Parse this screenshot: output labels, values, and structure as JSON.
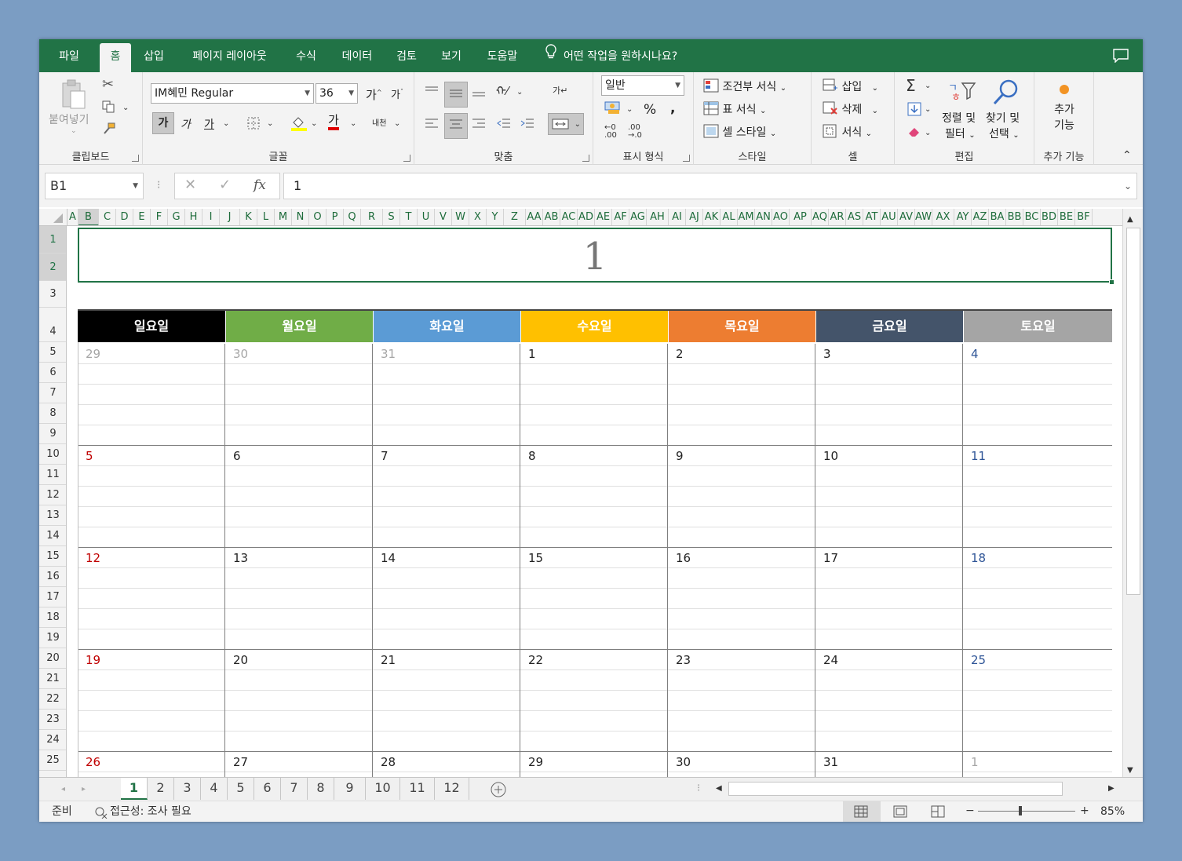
{
  "menu": {
    "tabs": [
      "파일",
      "홈",
      "삽입",
      "페이지 레이아웃",
      "수식",
      "데이터",
      "검토",
      "보기",
      "도움말"
    ],
    "tell_me": "어떤 작업을 원하시나요?"
  },
  "ribbon": {
    "clipboard": {
      "paste": "붙여넣기",
      "label": "클립보드"
    },
    "font": {
      "family": "IM혜민 Regular",
      "size": "36",
      "bold": "가",
      "italic": "가",
      "underline": "가",
      "grow": "가",
      "shrink": "가",
      "font_color": "가",
      "phonetic": "내천",
      "label": "글꼴"
    },
    "alignment": {
      "label": "맞춤"
    },
    "number": {
      "format": "일반",
      "percent": "%",
      "comma": ",",
      "label": "표시 형식"
    },
    "styles": {
      "conditional": "조건부 서식",
      "table": "표 서식",
      "cell": "셀 스타일",
      "label": "스타일"
    },
    "cells": {
      "insert": "삽입",
      "delete": "삭제",
      "format": "서식",
      "label": "셀"
    },
    "editing": {
      "sort": "정렬 및",
      "sort2": "필터",
      "find": "찾기 및",
      "find2": "선택",
      "label": "편집"
    },
    "addins": {
      "line1": "추가",
      "line2": "기능",
      "label": "추가 기능"
    }
  },
  "formula_bar": {
    "name_box": "B1",
    "fx": "fx",
    "value": "1"
  },
  "columns": [
    "A",
    "B",
    "C",
    "D",
    "E",
    "F",
    "G",
    "H",
    "I",
    "J",
    "K",
    "L",
    "M",
    "N",
    "O",
    "P",
    "Q",
    "R",
    "S",
    "T",
    "U",
    "V",
    "W",
    "X",
    "Y",
    "Z",
    "AA",
    "AB",
    "AC",
    "AD",
    "AE",
    "AF",
    "AG",
    "AH",
    "AI",
    "AJ",
    "AK",
    "AL",
    "AM",
    "AN",
    "AO",
    "AP",
    "AQ",
    "AR",
    "AS",
    "AT",
    "AU",
    "AV",
    "AW",
    "AX",
    "AY",
    "AZ",
    "BA",
    "BB",
    "BC",
    "BD",
    "BE",
    "BF"
  ],
  "rows": [
    "1",
    "2",
    "3",
    "4",
    "5",
    "6",
    "7",
    "8",
    "9",
    "10",
    "11",
    "12",
    "13",
    "14",
    "15",
    "16",
    "17",
    "18",
    "19",
    "20",
    "21",
    "22",
    "23",
    "24",
    "25"
  ],
  "calendar": {
    "title": "1",
    "days": [
      {
        "name": "일요일",
        "color": "#000000"
      },
      {
        "name": "월요일",
        "color": "#70ad47"
      },
      {
        "name": "화요일",
        "color": "#5b9bd5"
      },
      {
        "name": "수요일",
        "color": "#ffc000"
      },
      {
        "name": "목요일",
        "color": "#ed7d31"
      },
      {
        "name": "금요일",
        "color": "#44546a"
      },
      {
        "name": "토요일",
        "color": "#a5a5a5"
      }
    ],
    "weeks": [
      [
        "29",
        "30",
        "31",
        "1",
        "2",
        "3",
        "4"
      ],
      [
        "5",
        "6",
        "7",
        "8",
        "9",
        "10",
        "11"
      ],
      [
        "12",
        "13",
        "14",
        "15",
        "16",
        "17",
        "18"
      ],
      [
        "19",
        "20",
        "21",
        "22",
        "23",
        "24",
        "25"
      ],
      [
        "26",
        "27",
        "28",
        "29",
        "30",
        "31",
        "1"
      ]
    ],
    "colors": {
      "sunday": "#c00000",
      "saturday": "#2f5597",
      "other_month": "#a6a6a6",
      "weekday": "#222222"
    }
  },
  "sheet_tabs": [
    "1",
    "2",
    "3",
    "4",
    "5",
    "6",
    "7",
    "8",
    "9",
    "10",
    "11",
    "12"
  ],
  "active_sheet": "1",
  "status": {
    "ready": "준비",
    "accessibility": "접근성: 조사 필요",
    "zoom": "85%"
  }
}
